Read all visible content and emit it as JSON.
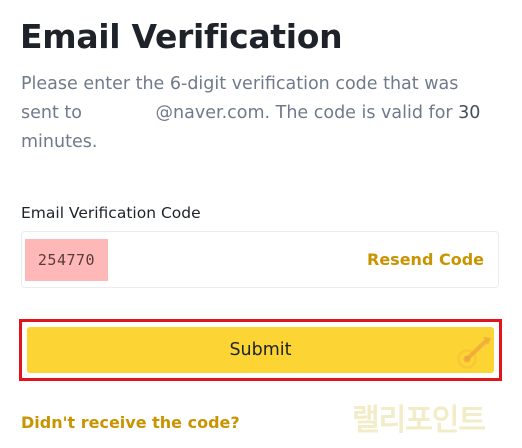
{
  "page": {
    "title": "Email Verification"
  },
  "description": {
    "line1": "Please enter the 6-digit verification code that was",
    "line2_prefix": "sent to",
    "line2_suffix": "@naver.com. The code is valid for ",
    "line2_number": "30",
    "line3": "minutes."
  },
  "form": {
    "code_label": "Email Verification Code",
    "code_value": "254770",
    "resend_label": "Resend Code",
    "submit_label": "Submit",
    "didnt_receive_label": "Didn't receive the code?"
  },
  "watermark": {
    "text": "랠리포인트"
  },
  "colors": {
    "accent_yellow": "#fcd535",
    "link_gold": "#c99400",
    "highlight_red": "#e1141b",
    "code_highlight": "#ffb8b8"
  },
  "icons": {
    "submit_decoration": "arrow-target-icon"
  }
}
